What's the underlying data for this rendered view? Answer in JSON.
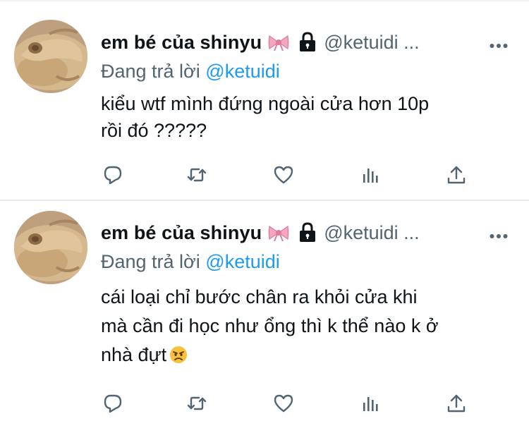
{
  "tweets": [
    {
      "display_name": "em bé của shinyu",
      "name_emoji": "ribbon",
      "protected_icon": "lock-icon",
      "handle": "@ketuidi ...",
      "reply_prefix": "Đang trả lời",
      "reply_to": "@ketuidi",
      "text_lines": [
        "kiểu wtf mình đứng ngoài cửa hơn 10p",
        "rồi đó ?????"
      ],
      "actions": [
        "reply-icon",
        "retweet-icon",
        "like-icon",
        "views-icon",
        "share-icon"
      ]
    },
    {
      "display_name": "em bé của shinyu",
      "name_emoji": "ribbon",
      "protected_icon": "lock-icon",
      "handle": "@ketuidi ...",
      "reply_prefix": "Đang trả lời",
      "reply_to": "@ketuidi",
      "text_lines": [
        "cái loại chỉ bước chân ra khỏi cửa khi",
        "mà cần đi học như ổng thì k thể nào k ở",
        "nhà đựt"
      ],
      "trailing_emoji": "angry-face",
      "actions": [
        "reply-icon",
        "retweet-icon",
        "like-icon",
        "views-icon",
        "share-icon"
      ]
    }
  ],
  "colors": {
    "text": "#0f1419",
    "secondary": "#536471",
    "link": "#1d9bf0",
    "divider": "#e6ecf0"
  }
}
